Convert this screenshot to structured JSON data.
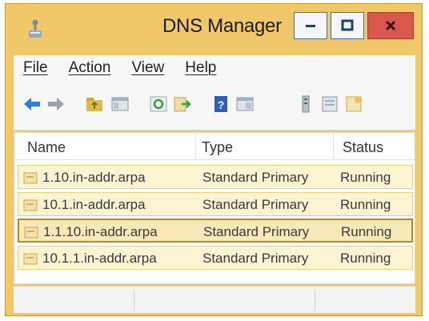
{
  "window": {
    "title": "DNS Manager"
  },
  "menu": [
    "File",
    "Action",
    "View",
    "Help"
  ],
  "toolbar": {
    "icons": [
      "back-arrow-icon",
      "forward-arrow-icon",
      "up-folder-icon",
      "show-console-tree-icon",
      "refresh-icon",
      "export-list-icon",
      "help-icon",
      "properties-icon",
      "server-icon",
      "zone-icon",
      "new-zone-icon"
    ]
  },
  "list": {
    "columns": [
      "Name",
      "Type",
      "Status"
    ],
    "rows": [
      {
        "name": "1.10.in-addr.arpa",
        "type": "Standard Primary",
        "status": "Running"
      },
      {
        "name": "10.1.in-addr.arpa",
        "type": "Standard Primary",
        "status": "Running"
      },
      {
        "name": "1.1.10.in-addr.arpa",
        "type": "Standard Primary",
        "status": "Running"
      },
      {
        "name": "10.1.1.in-addr.arpa",
        "type": "Standard Primary",
        "status": "Running"
      }
    ]
  },
  "colors": {
    "window_frame": "#f0c86a",
    "close_button": "#d9574e",
    "row_highlight": "#fbf4d2"
  }
}
